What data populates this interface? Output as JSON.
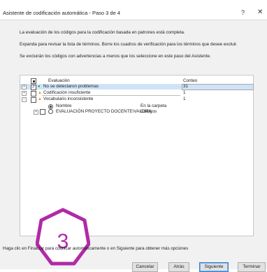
{
  "window": {
    "title": "Asistente de codificación automática - Paso 3 de 4",
    "help_label": "?",
    "close_label": "✕"
  },
  "instructions": [
    "La evaluación de los códigos para la codificación basada en patrones está completa.",
    "Expanda para revisar la lista de términos. Borre los cuadros de verificación para los términos que desee excluir.",
    "Se excluirán los códigos con advertencias a menos que los seleccione en este paso del Asistente."
  ],
  "grid": {
    "col_evaluation": "Evaluación",
    "col_count": "Conteo",
    "rows": [
      {
        "label": "No se detectaron problemas",
        "count": "31",
        "checked": true,
        "status": "ok",
        "expander": "+"
      },
      {
        "label": "Codificación insuficiente",
        "count": "1",
        "checked": false,
        "status": "warning",
        "expander": "+"
      },
      {
        "label": "Vocabulario inconsistente",
        "count": "1",
        "checked": false,
        "status": "warning",
        "expander": "−"
      }
    ],
    "sub_header": {
      "name": "Nombre",
      "in_folder": "En la carpeta"
    },
    "sub_row": {
      "name": "EVALUACIÓN PROYECTO DOCENTE\\VALORA",
      "in_folder": "Códigos",
      "expander": "+"
    }
  },
  "badge": {
    "number": "3",
    "color": "#b02aa6"
  },
  "footer": {
    "hint": "Haga clic en Finalizar para codificar automáticamente o en Siguiente para obtener más opciones",
    "buttons": {
      "cancel": "Cancelar",
      "back": "Atrás",
      "next": "Siguiente",
      "finish": "Terminar"
    }
  },
  "colors": {
    "ok_icon": "#2e9a2e",
    "warning_icon": "#d6a100",
    "selection": "#cfe3f7"
  }
}
